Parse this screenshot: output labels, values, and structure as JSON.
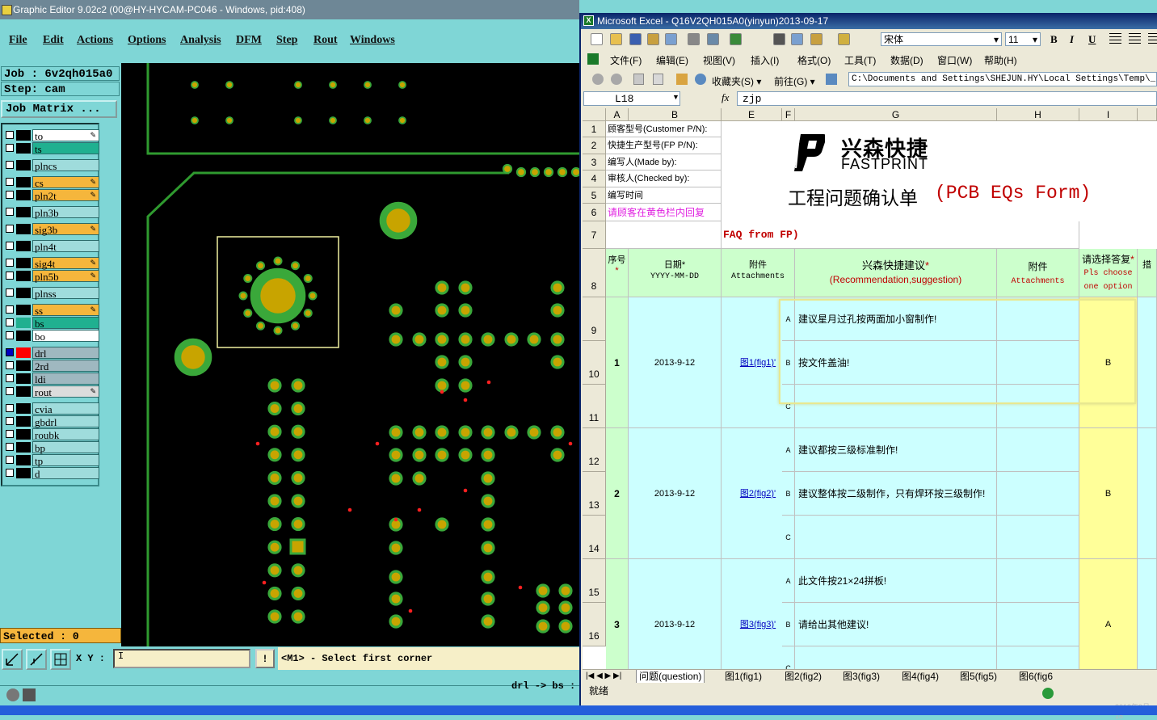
{
  "graphic_editor": {
    "title": "Graphic Editor 9.02c2 (00@HY-HYCAM-PC046 - Windows, pid:408)",
    "menu": [
      "File",
      "Edit",
      "Actions",
      "Options",
      "Analysis",
      "DFM",
      "Step",
      "Rout",
      "Windows"
    ],
    "job_label": "Job : 6v2qh015a0",
    "step_label": "Step: cam",
    "job_matrix": "Job Matrix ...",
    "layers": [
      {
        "name": "to",
        "color": "#ffffff"
      },
      {
        "name": "ts",
        "color": "#20b090"
      },
      {
        "name": "plncs",
        "color": "#9fdcdc"
      },
      {
        "name": "cs",
        "color": "#f5b63c"
      },
      {
        "name": "pln2t",
        "color": "#f5b63c"
      },
      {
        "name": "pln3b",
        "color": "#9fdcdc"
      },
      {
        "name": "sig3b",
        "color": "#f5b63c"
      },
      {
        "name": "pln4t",
        "color": "#9fdcdc"
      },
      {
        "name": "sig4t",
        "color": "#f5b63c"
      },
      {
        "name": "pln5b",
        "color": "#f5b63c"
      },
      {
        "name": "plnss",
        "color": "#9fdcdc"
      },
      {
        "name": "ss",
        "color": "#f5b63c"
      },
      {
        "name": "bs",
        "color": "#20b090"
      },
      {
        "name": "bo",
        "color": "#ffffff"
      },
      {
        "name": "drl",
        "color": "#9fb8c0"
      },
      {
        "name": "2rd",
        "color": "#9fb8c0"
      },
      {
        "name": "ldi",
        "color": "#9fb8c0"
      },
      {
        "name": "rout",
        "color": "#dcdcdc"
      },
      {
        "name": "cvia",
        "color": "#9fdcdc"
      },
      {
        "name": "gbdrl",
        "color": "#9fdcdc"
      },
      {
        "name": "roubk",
        "color": "#9fdcdc"
      },
      {
        "name": "bp",
        "color": "#9fdcdc"
      },
      {
        "name": "tp",
        "color": "#9fdcdc"
      },
      {
        "name": "d",
        "color": "#9fdcdc"
      }
    ],
    "selected": "Selected : 0",
    "xy_label": "X Y :",
    "xy_value": "I",
    "prompt": "<M1> - Select first corner",
    "status": "drl -> bs :"
  },
  "excel": {
    "title": "Microsoft Excel - Q16V2QH015A0(yinyun)2013-09-17",
    "font_name": "宋体",
    "font_size": "11",
    "menu": [
      "文件(F)",
      "编辑(E)",
      "视图(V)",
      "插入(I)",
      "格式(O)",
      "工具(T)",
      "数据(D)",
      "窗口(W)",
      "帮助(H)"
    ],
    "web_toolbar": {
      "favorites": "收藏夹(S) ▾",
      "go": "前往(G) ▾",
      "address": "C:\\Documents and Settings\\SHEJUN.HY\\Local Settings\\Temp\\_tc\\Q16"
    },
    "name_box": "L18",
    "formula_fx": "fx",
    "formula": "zjp",
    "columns": [
      "A",
      "B",
      "E",
      "F",
      "G",
      "H",
      "I"
    ],
    "rows": [
      "1",
      "2",
      "3",
      "4",
      "5",
      "6",
      "7",
      "8",
      "9",
      "10",
      "11",
      "12",
      "13",
      "14",
      "15",
      "16"
    ],
    "labels": {
      "customer_pn": "顾客型号(Customer P/N):",
      "fp_pn": "快捷生产型号(FP P/N):",
      "made_by": "编写人(Made by):",
      "checked_by": "审核人(Checked by):",
      "write_time": "编写时间",
      "reply_note": "请顾客在黄色栏内回复",
      "faq": "FAQ from FP)"
    },
    "logo_cn": "兴森快捷",
    "logo_en": "FASTPRINT",
    "form_title_cn": "工程问题确认单",
    "form_title_en": "(PCB EQs Form)",
    "headers": {
      "seq": "序号",
      "date": "日期*",
      "date_fmt": "YYYY-MM-DD",
      "attach": "附件",
      "attach_en": "Attachments",
      "suggest": "兴森快捷建议",
      "suggest_en": "(Recommendation,suggestion)",
      "attach2": "附件",
      "attach2_en": "Attachments",
      "choose": "请选择答复",
      "choose_en1": "Pls choose",
      "choose_en2": "one option",
      "cut": "措"
    },
    "questions": [
      {
        "no": "1",
        "date": "2013-9-12",
        "fig": "图1(fig1)'",
        "options": [
          {
            "key": "A",
            "text": "建议星月过孔按两面加小窗制作!"
          },
          {
            "key": "B",
            "text": "按文件盖油!"
          },
          {
            "key": "C",
            "text": ""
          }
        ],
        "answer": "B"
      },
      {
        "no": "2",
        "date": "2013-9-12",
        "fig": "图2(fig2)'",
        "options": [
          {
            "key": "A",
            "text": "建议都按三级标准制作!"
          },
          {
            "key": "B",
            "text": "建议整体按二级制作，只有焊环按三级制作!"
          },
          {
            "key": "C",
            "text": ""
          }
        ],
        "answer": "B"
      },
      {
        "no": "3",
        "date": "2013-9-12",
        "fig": "图3(fig3)'",
        "options": [
          {
            "key": "A",
            "text": "此文件按21×24拼板!"
          },
          {
            "key": "B",
            "text": "请给出其他建议!"
          },
          {
            "key": "C",
            "text": ""
          }
        ],
        "answer": "A"
      }
    ],
    "sheet_tabs": [
      "问题(question)",
      "图1(fig1)",
      "图2(fig2)",
      "图3(fig3)",
      "图4(fig4)",
      "图5(fig5)",
      "图6(fig6"
    ],
    "status": "就绪",
    "clock": "2013年9月18"
  },
  "colors": {
    "pad_fill": "#c8a400",
    "pad_ring": "#3aa83a",
    "trace": "#2f9a2f",
    "drill_red": "#ff2020"
  }
}
